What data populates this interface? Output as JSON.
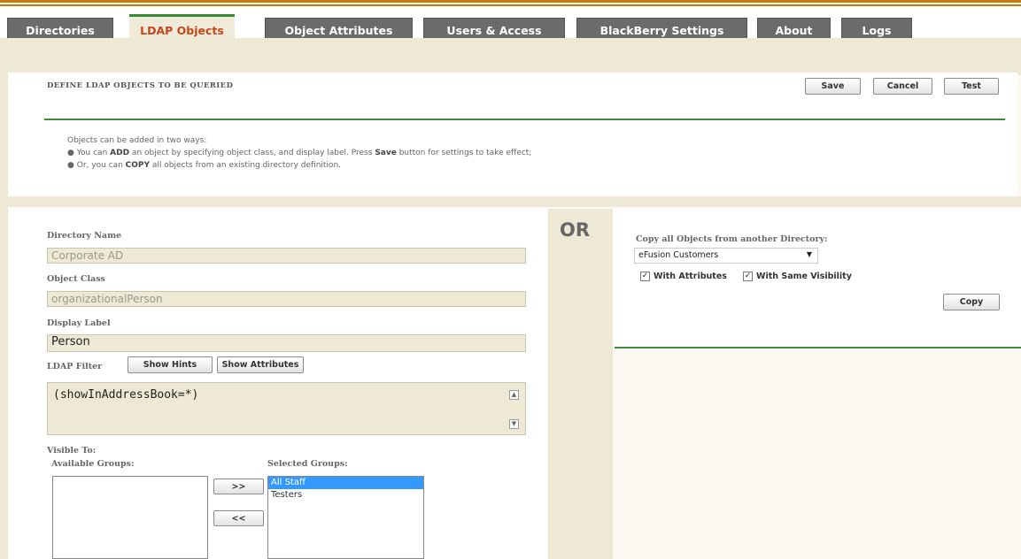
{
  "tabs": [
    "Directories",
    "LDAP Objects",
    "Object Attributes",
    "Users & Access",
    "BlackBerry Settings",
    "About",
    "Logs"
  ],
  "header": {
    "title": "DEFINE LDAP OBJECTS TO BE QUERIED",
    "save_label": "Save",
    "cancel_label": "Cancel",
    "test_label": "Test"
  },
  "info": {
    "intro": "Objects can be added in two ways:",
    "line1_a": "You can ",
    "line1_b": "ADD",
    "line1_c": " an object by specifying object class, and display label. Press ",
    "line1_d": "Save",
    "line1_e": " button for settings to take effect;",
    "line2_a": "Or, you can ",
    "line2_b": "COPY",
    "line2_c": " all objects from an existing directory definition."
  },
  "form": {
    "directory_name_label": "Directory Name",
    "directory_name_value": "Corporate AD",
    "object_class_label": "Object Class",
    "object_class_value": "organizationalPerson",
    "display_label_label": "Display Label",
    "display_label_value": "Person",
    "ldap_filter_label": "LDAP Filter",
    "show_hints_label": "Show Hints",
    "show_attributes_label": "Show Attributes",
    "ldap_filter_value": "(showInAddressBook=*)",
    "visible_to_label": "Visible To:",
    "available_groups_label": "Available Groups:",
    "selected_groups_label": "Selected Groups:",
    "add_arrow_label": ">>",
    "remove_arrow_label": "<<",
    "available_groups": [],
    "selected_groups": [
      "All Staff",
      "Testers"
    ]
  },
  "or_label": "OR",
  "copy": {
    "title": "Copy all Objects from another Directory:",
    "selected_directory": "eFusion Customers",
    "with_attributes_label": "With Attributes",
    "with_same_visibility_label": "With Same Visibility",
    "copy_label": "Copy"
  },
  "colors": {
    "tab_active_text": "#c5471b",
    "tab_bg": "#6b6b6b",
    "accent_green": "#3c8b3c",
    "top_stripe": "#c47a12"
  }
}
